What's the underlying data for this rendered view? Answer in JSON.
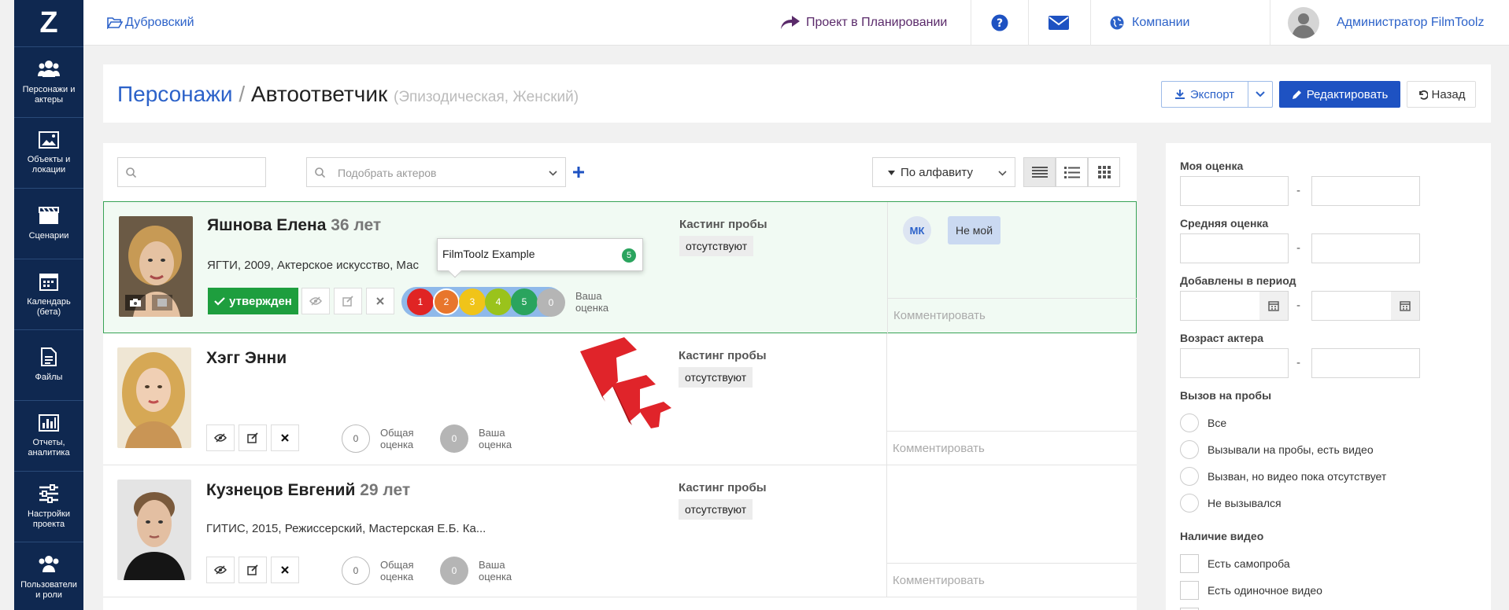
{
  "app": {
    "logo": "Z"
  },
  "sidebar": {
    "items": [
      {
        "label": "Персонажи и актеры"
      },
      {
        "label": "Объекты и локации"
      },
      {
        "label": "Сценарии"
      },
      {
        "label": "Календарь (бета)"
      },
      {
        "label": "Файлы"
      },
      {
        "label": "Отчеты, аналитика"
      },
      {
        "label": "Настройки проекта"
      },
      {
        "label": "Пользователи и роли"
      }
    ]
  },
  "topbar": {
    "project": "Дубровский",
    "planning": "Проект в Планировании",
    "companies": "Компании",
    "user": "Администратор FilmToolz"
  },
  "header": {
    "breadcrumb": "Персонажи",
    "separator": "/",
    "title": "Автоответчик",
    "subtitle": "(Эпизодическая, Женский)",
    "export": "Экспорт",
    "edit": "Редактировать",
    "back": "Назад"
  },
  "toolbar": {
    "actor_placeholder": "Подобрать актеров",
    "sort": "По алфавиту"
  },
  "actors": [
    {
      "name": "Яшнова Елена",
      "age": "36 лет",
      "education": "ЯГТИ, 2009, Актерское искусство, Мас",
      "status": "утвержден",
      "casting_label": "Кастинг пробы",
      "casting_value": "отсутствуют",
      "comment_placeholder": "Комментировать",
      "your_rating_label": "Ваша оценка",
      "avatar": "МК",
      "tag": "Не мой",
      "rating_options": [
        "1",
        "2",
        "3",
        "4",
        "5"
      ],
      "your_rating": "0"
    },
    {
      "name": "Хэгг Энни",
      "age": "",
      "education": "",
      "casting_label": "Кастинг пробы",
      "casting_value": "отсутствуют",
      "comment_placeholder": "Комментировать",
      "overall_label": "Общая оценка",
      "overall": "0",
      "your_label": "Ваша оценка",
      "your": "0"
    },
    {
      "name": "Кузнецов Евгений",
      "age": "29 лет",
      "education": "ГИТИС, 2015, Режиссерский, Мастерская Е.Б. Ка...",
      "casting_label": "Кастинг пробы",
      "casting_value": "отсутствуют",
      "comment_placeholder": "Комментировать",
      "overall_label": "Общая оценка",
      "overall": "0",
      "your_label": "Ваша оценка",
      "your": "0"
    }
  ],
  "tooltip": {
    "text": "FilmToolz Example",
    "count": "5"
  },
  "filters": {
    "my_rating": "Моя оценка",
    "avg_rating": "Средняя оценка",
    "added_period": "Добавлены в период",
    "actor_age": "Возраст актера",
    "dash": "-",
    "call_title": "Вызов на пробы",
    "call_options": [
      "Все",
      "Вызывали на пробы, есть видео",
      "Вызван, но видео пока отсутствует",
      "Не вызывался"
    ],
    "video_title": "Наличие видео",
    "video_options": [
      "Есть самопроба",
      "Есть одиночное видео"
    ]
  },
  "colors": {
    "sidebar": "#0f2850",
    "accent": "#1e52c2",
    "approved": "#1e9e3e",
    "arrow": "#e0242a"
  }
}
